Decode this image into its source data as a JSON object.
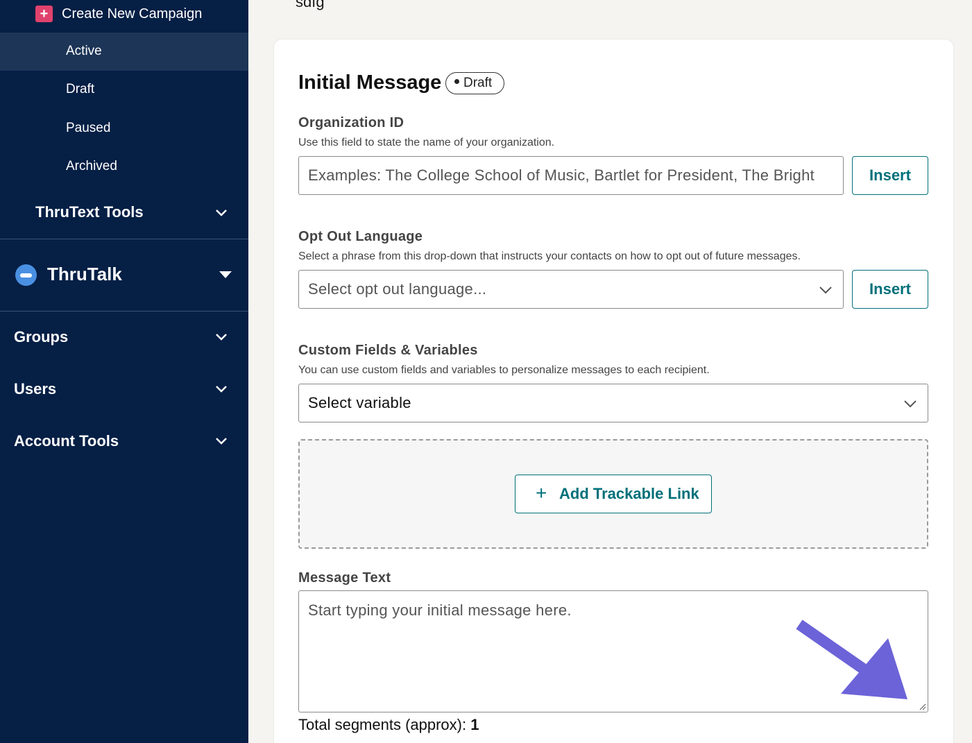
{
  "sidebar": {
    "create_label": "Create New Campaign",
    "campaign_items": [
      "Active",
      "Draft",
      "Paused",
      "Archived"
    ],
    "thrutext_tools": "ThruText Tools",
    "thrutalk": "ThruTalk",
    "nav": [
      "Groups",
      "Users",
      "Account Tools"
    ]
  },
  "main": {
    "top_text": "sdfg",
    "heading": "Initial Message",
    "badge": "Draft",
    "org": {
      "label": "Organization ID",
      "help": "Use this field to state the name of your organization.",
      "placeholder": "Examples: The College School of Music, Bartlet for President, The Bright",
      "insert": "Insert"
    },
    "optout": {
      "label": "Opt Out Language",
      "help": "Select a phrase from this drop-down that instructs your contacts on how to opt out of future messages.",
      "placeholder": "Select opt out language...",
      "insert": "Insert"
    },
    "custom": {
      "label": "Custom Fields & Variables",
      "help": "You can use custom fields and variables to personalize messages to each recipient.",
      "value": "Select variable"
    },
    "trackable_link": "Add Trackable Link",
    "message": {
      "label": "Message Text",
      "placeholder": "Start typing your initial message here."
    },
    "segments_label": "Total segments (approx):",
    "segments_value": "1"
  },
  "colors": {
    "sidebar_bg": "#051f45",
    "accent": "#00707a",
    "create_icon": "#e0426d",
    "annotation_arrow": "#6c63d8"
  }
}
